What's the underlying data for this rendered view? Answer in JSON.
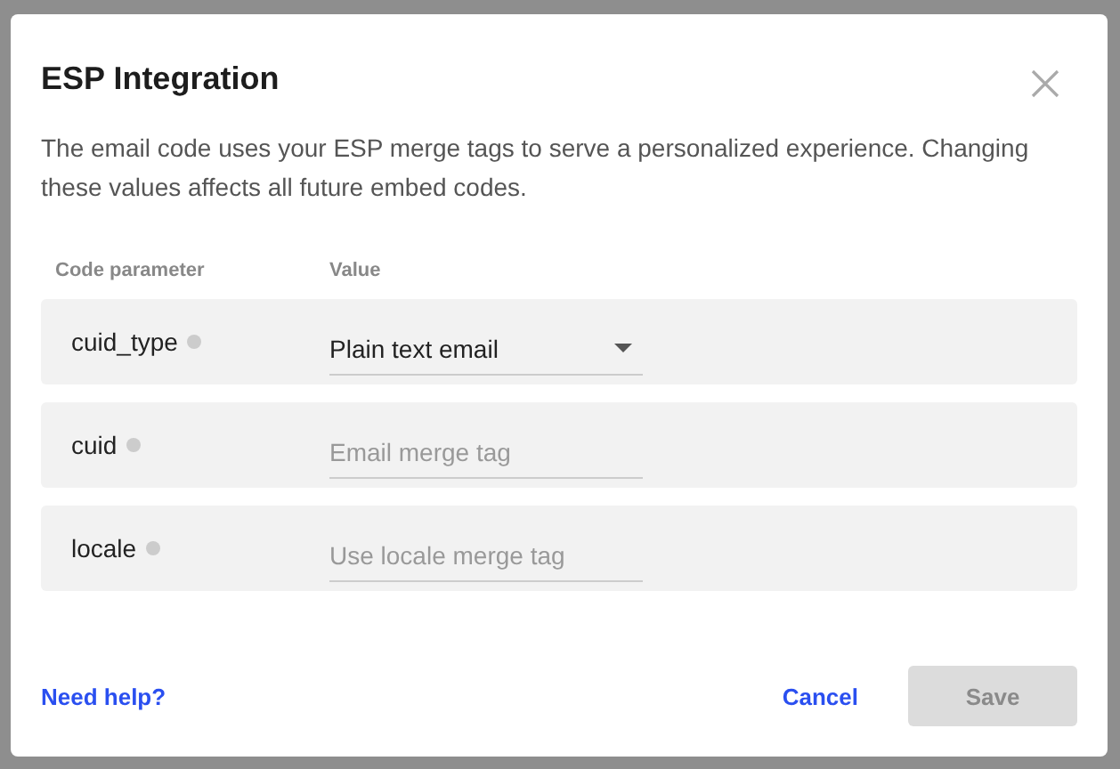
{
  "dialog": {
    "title": "ESP Integration",
    "description": "The email code uses your ESP merge tags to serve a personalized experience. Changing these values affects all future embed codes."
  },
  "table": {
    "columns": [
      "Code parameter",
      "Value"
    ],
    "rows": [
      {
        "parameter": "cuid_type",
        "kind": "select",
        "value": "Plain text email"
      },
      {
        "parameter": "cuid",
        "kind": "input",
        "placeholder": "Email merge tag"
      },
      {
        "parameter": "locale",
        "kind": "input",
        "placeholder": "Use locale merge tag"
      }
    ]
  },
  "footer": {
    "help_link": "Need help?",
    "cancel": "Cancel",
    "save": {
      "label": "Save",
      "disabled": true
    }
  }
}
